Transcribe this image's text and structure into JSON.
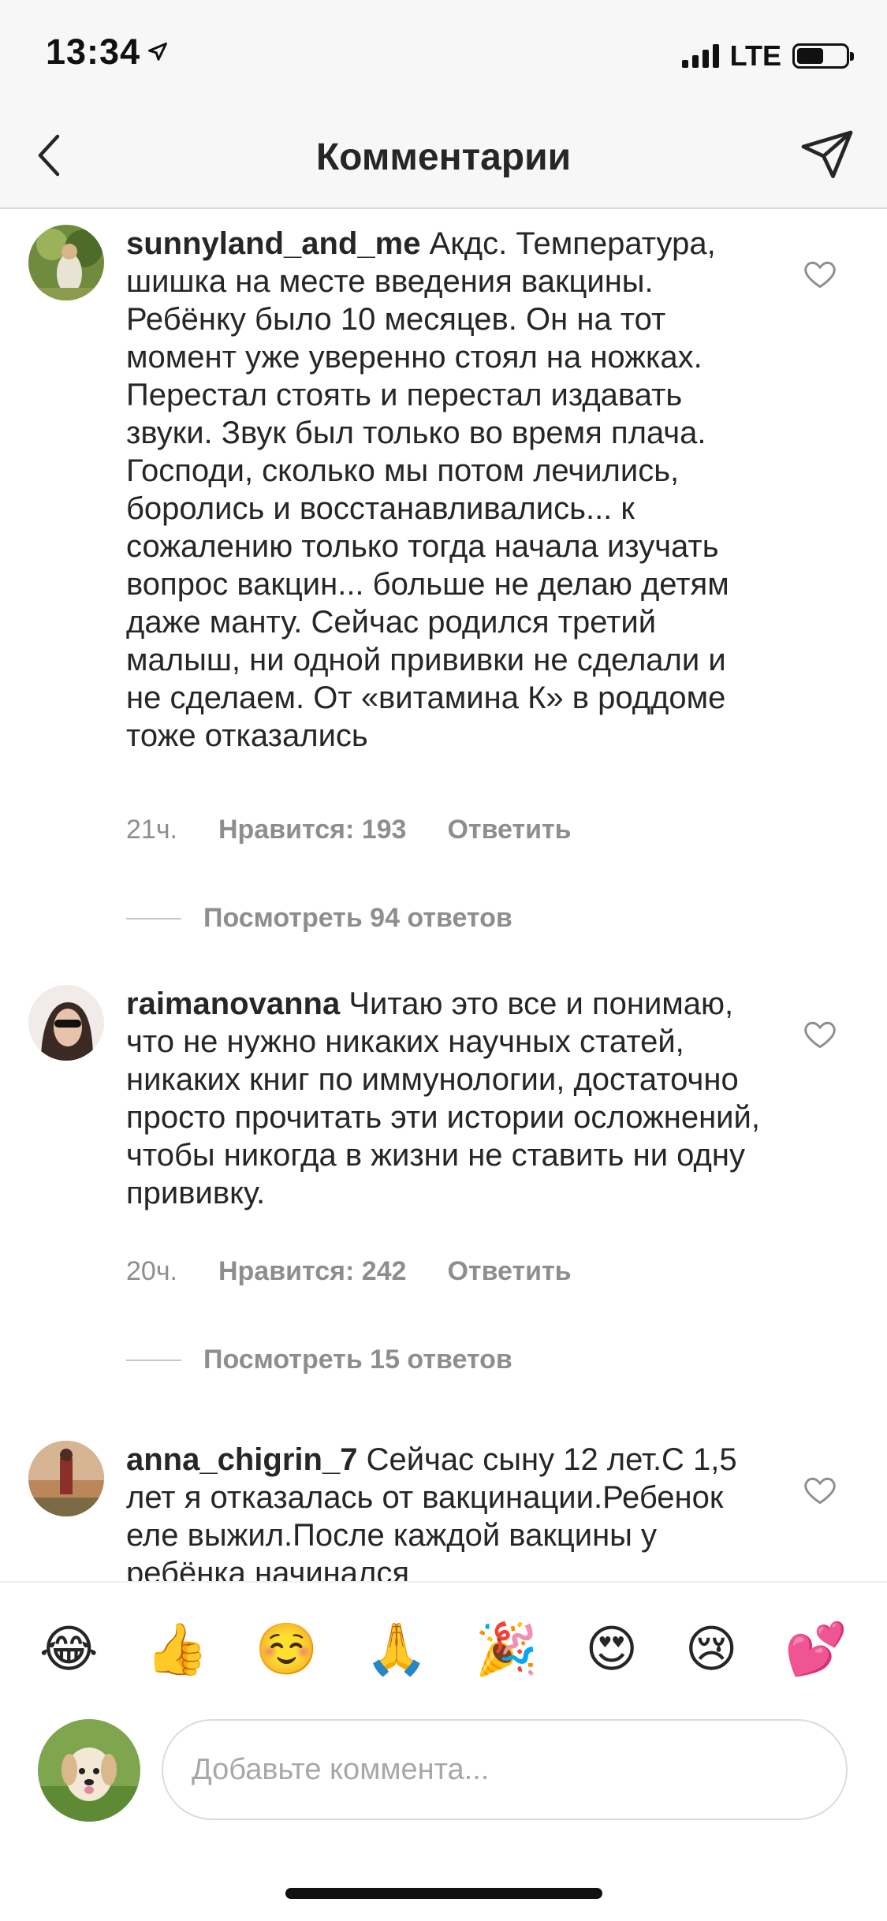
{
  "status_bar": {
    "time": "13:34",
    "network": "LTE",
    "battery_percent": 55
  },
  "header": {
    "title": "Комментарии",
    "back_icon": "chevron-left-icon",
    "send_icon": "paper-plane-icon"
  },
  "comments": [
    {
      "username": "sunnyland_and_me",
      "text": "Акдс. Температура, шишка на месте введения вакцины. Ребёнку было 10 месяцев. Он на тот момент уже уверенно стоял на ножках. Перестал стоять и перестал издавать звуки. Звук был только во время плача. Господи, сколько мы потом лечились, боролись и восстанавливались... к сожалению только тогда начала изучать вопрос вакцин... больше не делаю детям даже манту. Сейчас родился третий малыш, ни одной прививки не сделали и не сделаем. От «витамина К» в роддоме тоже отказались",
      "time": "21ч.",
      "likes": "Нравится: 193",
      "reply": "Ответить",
      "view_replies": "Посмотреть 94 ответов"
    },
    {
      "username": "raimanovanna",
      "text": "Читаю это все и понимаю, что не нужно никаких научных статей, никаких книг по иммунологии, достаточно просто прочитать эти истории осложнений, чтобы никогда в жизни не ставить ни одну прививку.",
      "time": "20ч.",
      "likes": "Нравится: 242",
      "reply": "Ответить",
      "view_replies": "Посмотреть 15 ответов"
    },
    {
      "username": "anna_chigrin_7",
      "text": "Сейчас сыну 12 лет.С 1,5 лет я отказалась от вакцинации.Ребенок еле выжил.После каждой вакцины у ребёнка начинался"
    }
  ],
  "emoji_bar": [
    "😂",
    "👍",
    "☺️",
    "🙏",
    "🎉",
    "😍",
    "😢",
    "💕"
  ],
  "input": {
    "placeholder": "Добавьте коммента..."
  }
}
